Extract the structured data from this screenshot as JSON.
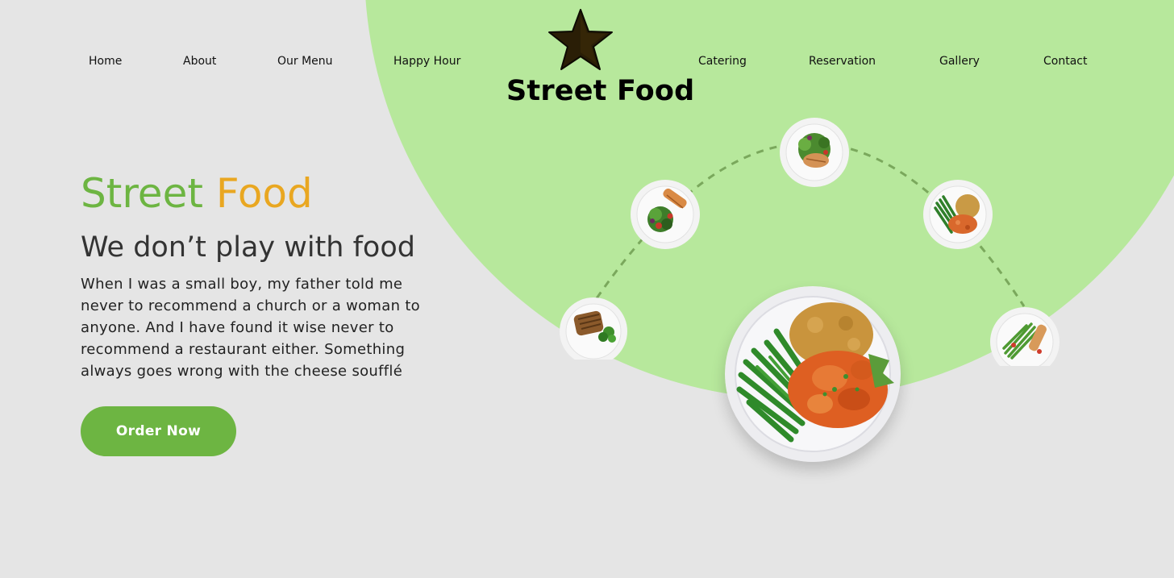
{
  "nav": {
    "left": [
      "Home",
      "About",
      "Our Menu",
      "Happy Hour"
    ],
    "right": [
      "Catering",
      "Reservation",
      "Gallery",
      "Contact"
    ]
  },
  "logo": {
    "icon": "star-icon",
    "title": "Street Food"
  },
  "hero": {
    "title_word1": "Street",
    "title_word2": "Food",
    "subtitle": "We don’t play with food",
    "body": "When I was a small boy, my father told me never to recommend a church or a woman to anyone. And I have found it wise never to recommend a restaurant either. Something always goes wrong with the cheese soufflé",
    "cta_label": "Order Now"
  },
  "colors": {
    "brand_green": "#6db542",
    "brand_orange": "#e9a721",
    "circle_bg": "#b7e89c",
    "page_bg": "#e5e5e5"
  },
  "dishes": [
    "steak-broccoli-plate",
    "salmon-salad-plate",
    "chicken-salad-plate",
    "chicken-rice-beans-plate",
    "asparagus-salmon-plate",
    "main-chicken-rice-green-beans-plate"
  ]
}
